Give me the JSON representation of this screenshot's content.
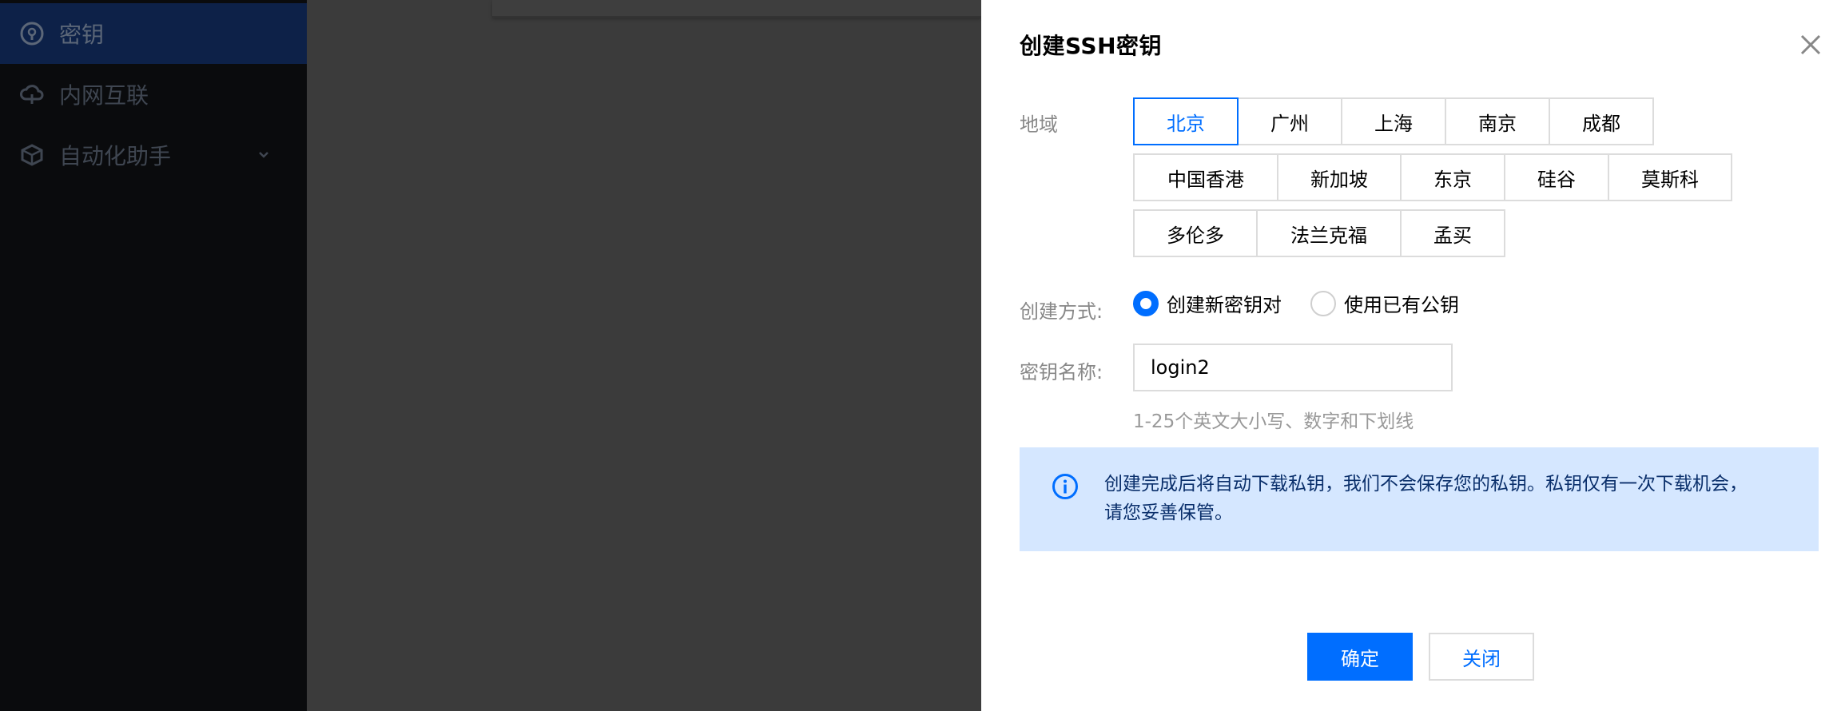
{
  "sidebar": {
    "items": [
      {
        "label": "密钥",
        "icon": "key-circle-icon",
        "active": true
      },
      {
        "label": "内网互联",
        "icon": "cloud-link-icon",
        "active": false
      },
      {
        "label": "自动化助手",
        "icon": "cube-icon",
        "active": false,
        "has_children": true
      }
    ]
  },
  "drawer": {
    "title": "创建SSH密钥",
    "region_label": "地域",
    "regions_row1": [
      "北京",
      "广州",
      "上海",
      "南京",
      "成都"
    ],
    "regions_row2": [
      "中国香港",
      "新加坡",
      "东京",
      "硅谷",
      "莫斯科"
    ],
    "regions_row3": [
      "多伦多",
      "法兰克福",
      "孟买"
    ],
    "selected_region": "北京",
    "method_label": "创建方式:",
    "methods": [
      {
        "label": "创建新密钥对",
        "checked": true
      },
      {
        "label": "使用已有公钥",
        "checked": false
      }
    ],
    "name_label": "密钥名称:",
    "name_value": "login2",
    "name_hint": "1-25个英文大小写、数字和下划线",
    "info_text": "创建完成后将自动下载私钥，我们不会保存您的私钥。私钥仅有一次下载机会，请您妥善保管。",
    "confirm_label": "确定",
    "close_label": "关闭"
  },
  "colors": {
    "primary": "#006eff",
    "info_bg": "#d5e7ff",
    "sidebar_bg": "#0a0b0d",
    "overlay": "#3b3b3b"
  }
}
